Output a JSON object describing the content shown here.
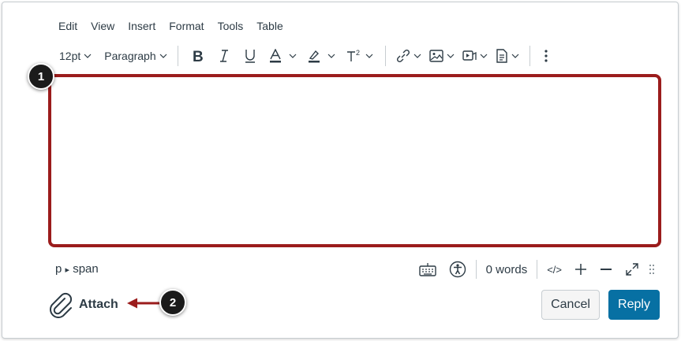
{
  "menubar": {
    "items": [
      "Edit",
      "View",
      "Insert",
      "Format",
      "Tools",
      "Table"
    ]
  },
  "toolbar": {
    "font_size": "12pt",
    "block_format": "Paragraph",
    "icons": [
      "bold-icon",
      "italic-icon",
      "underline-icon",
      "text-color-icon",
      "highlight-color-icon",
      "superscript-icon",
      "link-icon",
      "image-icon",
      "media-icon",
      "document-icon",
      "more-options-icon"
    ]
  },
  "callouts": {
    "editor_badge": "1",
    "attach_badge": "2"
  },
  "statusbar": {
    "path_p": "p",
    "path_sep": "▸",
    "path_span": "span",
    "word_count": "0 words",
    "html_toggle": "</>"
  },
  "attach": {
    "label": "Attach"
  },
  "actions": {
    "cancel_label": "Cancel",
    "reply_label": "Reply"
  },
  "colors": {
    "highlight_border": "#9b1c1c",
    "reply_bg": "#0770a3",
    "text": "#2d3b45"
  }
}
